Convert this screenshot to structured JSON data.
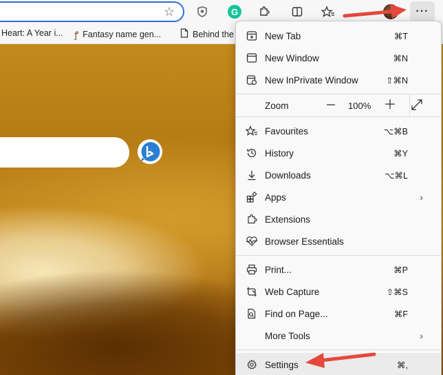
{
  "toolbar": {
    "icons": [
      "star-icon",
      "shield-extension-icon",
      "grammarly-icon",
      "extensions-icon",
      "split-screen-icon",
      "favorites-icon",
      "profile-avatar",
      "more-icon"
    ],
    "grammarly_letter": "G",
    "more_label": "···"
  },
  "bookmarks": [
    {
      "label": "Heart: A Year i...",
      "icon": "none"
    },
    {
      "label": "Fantasy name gen...",
      "icon": "figure-icon"
    },
    {
      "label": "Behind the",
      "icon": "page-icon"
    }
  ],
  "menu": {
    "items": [
      {
        "label": "New Tab",
        "shortcut": "⌘T",
        "icon": "new-tab-icon"
      },
      {
        "label": "New Window",
        "shortcut": "⌘N",
        "icon": "new-window-icon"
      },
      {
        "label": "New InPrivate Window",
        "shortcut": "⇧⌘N",
        "icon": "inprivate-icon"
      }
    ],
    "zoom": {
      "label": "Zoom",
      "value": "100%",
      "minus": "—",
      "plus": "+"
    },
    "items2": [
      {
        "label": "Favourites",
        "shortcut": "⌥⌘B",
        "icon": "favourites-icon"
      },
      {
        "label": "History",
        "shortcut": "⌘Y",
        "icon": "history-icon"
      },
      {
        "label": "Downloads",
        "shortcut": "⌥⌘L",
        "icon": "downloads-icon"
      },
      {
        "label": "Apps",
        "shortcut": "",
        "icon": "apps-icon",
        "chevron": "›"
      },
      {
        "label": "Extensions",
        "shortcut": "",
        "icon": "extensions-icon"
      },
      {
        "label": "Browser Essentials",
        "shortcut": "",
        "icon": "heart-pulse-icon"
      }
    ],
    "items3": [
      {
        "label": "Print...",
        "shortcut": "⌘P",
        "icon": "print-icon"
      },
      {
        "label": "Web Capture",
        "shortcut": "⇧⌘S",
        "icon": "web-capture-icon"
      },
      {
        "label": "Find on Page...",
        "shortcut": "⌘F",
        "icon": "find-icon"
      },
      {
        "label": "More Tools",
        "shortcut": "",
        "icon": "",
        "chevron": "›"
      }
    ],
    "settings": {
      "label": "Settings",
      "shortcut": "⌘,",
      "icon": "gear-icon"
    }
  },
  "colors": {
    "accent": "#2f6fd6",
    "arrow": "#e5483c",
    "grammarly": "#15c39a",
    "bing": "#2a7fd4"
  }
}
